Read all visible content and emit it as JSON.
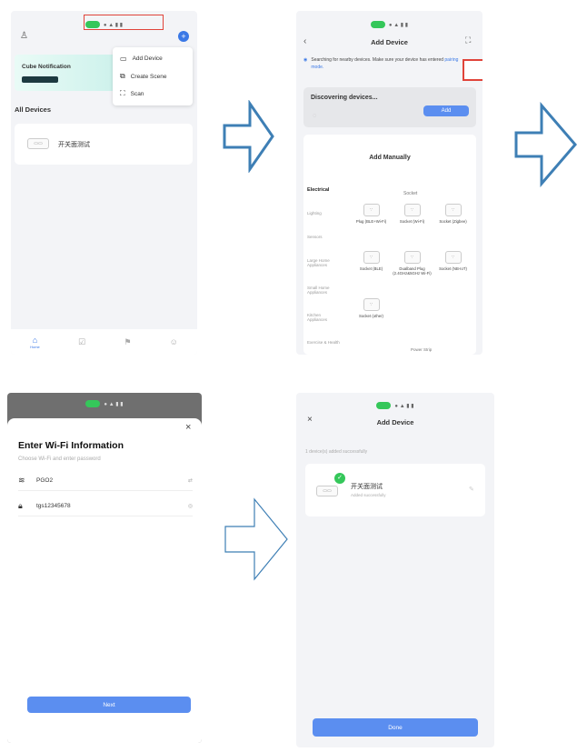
{
  "screen1": {
    "status_pill": "",
    "notification_title": "Cube Notification",
    "notification_button": "",
    "menu_items": [
      "Add Device",
      "Create Scene",
      "Scan"
    ],
    "section_title": "All Devices",
    "device_name": "开关面测试",
    "nav_labels": [
      "Home",
      "",
      "",
      ""
    ]
  },
  "screen2": {
    "title": "Add Device",
    "search_hint": "Searching for nearby devices. Make sure your device has entered",
    "search_link": "pairing mode.",
    "discovering": "Discovering devices...",
    "add_button": "Add",
    "add_manually": "Add Manually",
    "categories": [
      "Electrical",
      "Lighting",
      "Sensors",
      "Large Home Appliances",
      "Small Home Appliances",
      "Kitchen Appliances",
      "Exercise & Health"
    ],
    "category_header": "Socket",
    "devices": [
      {
        "name": "Plug (BLE+Wi-Fi)"
      },
      {
        "name": "Socket (Wi-Fi)"
      },
      {
        "name": "Socket (Zigbee)"
      },
      {
        "name": "Socket (BLE)"
      },
      {
        "name": "Dualband Plug (2.4GHz&5GHz Wi-Fi)"
      },
      {
        "name": "Socket (NB-IoT)"
      },
      {
        "name": "Socket (other)"
      }
    ],
    "footer_label": "Power Strip"
  },
  "screen3": {
    "title": "Enter Wi-Fi Information",
    "subtitle": "Choose Wi-Fi and enter password",
    "wifi_name": "PGO2",
    "password": "tgs12345678",
    "next_button": "Next"
  },
  "screen4": {
    "title": "Add Device",
    "added_text": "1 device(s) added successfully",
    "device_name": "开关面测试",
    "device_status": "Added successfully",
    "done_button": "Done"
  },
  "colors": {
    "accent": "#5b8ef0",
    "arrow": "#3e7fb5",
    "highlight": "#e0443a",
    "success": "#35c75a"
  }
}
